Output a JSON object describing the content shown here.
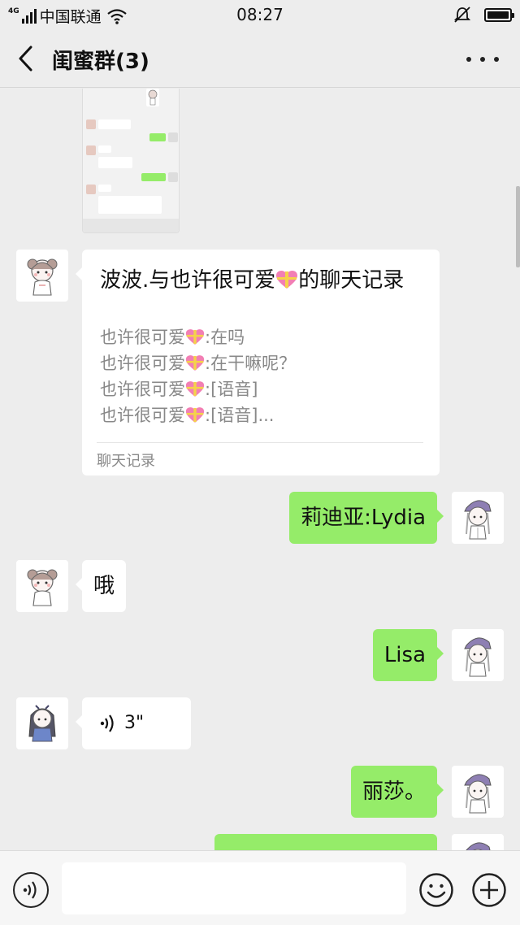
{
  "status_bar": {
    "network_type": "4G",
    "carrier": "中国联通",
    "time": "08:27"
  },
  "header": {
    "title": "闺蜜群(3)"
  },
  "record_card": {
    "title": "波波.与也许很可爱💖的聊天记录",
    "title_prefix": "波波.与也许很可爱",
    "title_suffix": "的聊天记录",
    "sender": "也许很可爱",
    "lines": [
      ":在吗",
      ":在干嘛呢？",
      ":[语音]",
      ":[语音]..."
    ],
    "footer": "聊天记录"
  },
  "messages": [
    {
      "side": "right",
      "text": "莉迪亚:Lydia"
    },
    {
      "side": "left",
      "text": "哦"
    },
    {
      "side": "right",
      "text": "Lisa"
    },
    {
      "side": "left",
      "type": "voice",
      "text": "3\""
    },
    {
      "side": "right",
      "text": "丽莎。"
    }
  ],
  "input_bar": {
    "placeholder": ""
  },
  "colors": {
    "background": "#ededed",
    "bubble_green": "#95ec69",
    "bubble_white": "#ffffff"
  },
  "icons": [
    "signal-icon",
    "wifi-icon",
    "mute-bell-icon",
    "battery-icon",
    "back-icon",
    "more-icon",
    "voice-input-icon",
    "emoji-icon",
    "plus-icon",
    "voice-wave-icon"
  ]
}
